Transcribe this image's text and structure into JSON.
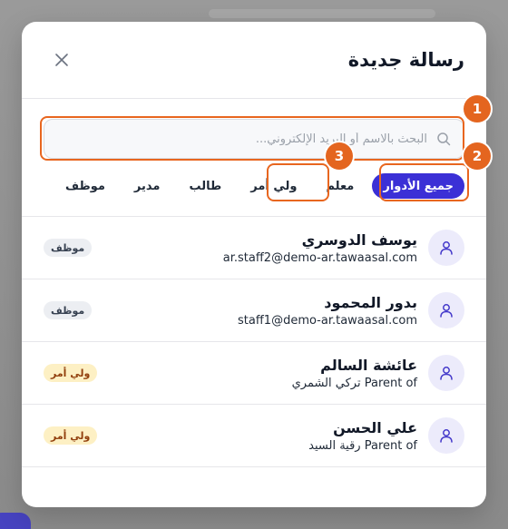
{
  "modal": {
    "title": "رسالة جديدة",
    "close_icon": "close-icon"
  },
  "search": {
    "placeholder": "البحث بالاسم أو البريد الإلكتروني...",
    "value": "",
    "icon": "search-icon"
  },
  "tabs": [
    {
      "label": "جميع الأدوار",
      "active": true
    },
    {
      "label": "معلم",
      "active": false
    },
    {
      "label": "ولي أمر",
      "active": false
    },
    {
      "label": "طالب",
      "active": false
    },
    {
      "label": "مدير",
      "active": false
    },
    {
      "label": "موظف",
      "active": false
    }
  ],
  "recipients": [
    {
      "name": "يوسف الدوسري",
      "sub": "ar.staff2@demo-ar.tawaasal.com",
      "role": "موظف",
      "role_type": "staff"
    },
    {
      "name": "بدور المحمود",
      "sub": "staff1@demo-ar.tawaasal.com",
      "role": "موظف",
      "role_type": "staff"
    },
    {
      "name": "عائشة السالم",
      "sub": "Parent of تركي الشمري",
      "role": "ولي أمر",
      "role_type": "parent"
    },
    {
      "name": "علي الحسن",
      "sub": "Parent of رقية السيد",
      "role": "ولي أمر",
      "role_type": "parent"
    }
  ],
  "annotations": [
    "1",
    "2",
    "3"
  ],
  "colors": {
    "accent": "#3b30d6",
    "annotation": "#e4651f",
    "parent_badge_bg": "#fdf0c4",
    "staff_badge_bg": "#eceef2",
    "avatar_bg": "#ecebfb"
  }
}
